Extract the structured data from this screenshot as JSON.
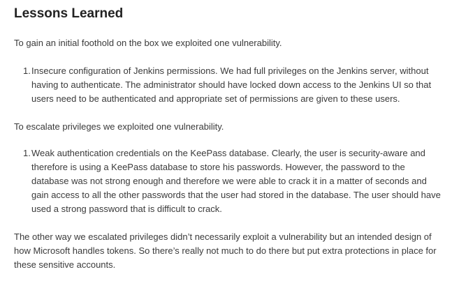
{
  "title": "Lessons Learned",
  "intro_foothold": "To gain an initial foothold on the box we exploited one vulnerability.",
  "foothold_list": [
    {
      "number": "1.",
      "text": "Insecure configuration of Jenkins permissions. We had full privileges on the Jenkins server, without having to authenticate. The administrator should have locked down access to the Jenkins UI so that users need to be authenticated and appropriate set of permissions are given to these users."
    }
  ],
  "intro_escalate": "To escalate privileges we exploited one vulnerability.",
  "escalate_list": [
    {
      "number": "1.",
      "text": "Weak authentication credentials on the KeePass database. Clearly, the user is security-aware and therefore is using a KeePass database to store his passwords. However, the password to the database was not strong enough and therefore we were able to crack it in a matter of seconds and gain access to all the other passwords that the user had stored in the database. The user should have used a strong password that is difficult to crack."
    }
  ],
  "closing": "The other way we escalated privileges didn’t necessarily exploit a vulnerability but an intended design of how Microsoft handles tokens. So there’s really not much to do there but put extra protections in place for these sensitive accounts."
}
